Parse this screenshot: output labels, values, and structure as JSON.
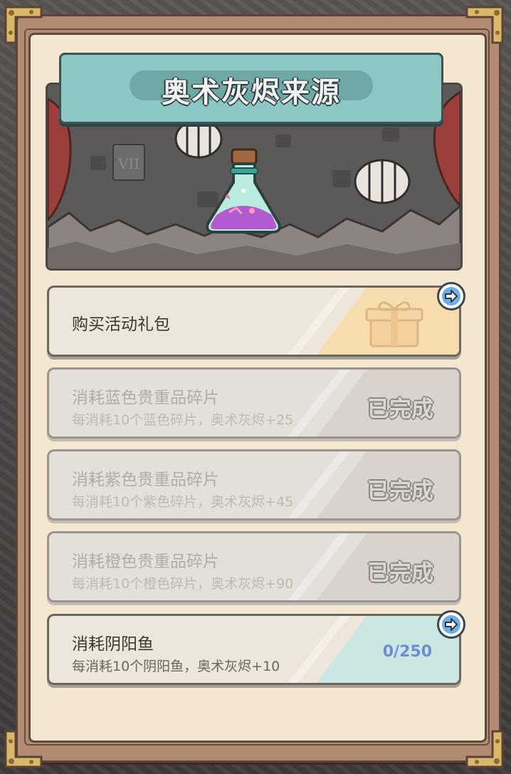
{
  "panel": {
    "title": "奥术灰烬来源"
  },
  "sources": [
    {
      "title": "购买活动礼包",
      "description": "",
      "status": "",
      "state": "available",
      "icon": "gift-box-icon"
    },
    {
      "title": "消耗蓝色贵重品碎片",
      "description": "每消耗10个蓝色碎片，奥术灰烬+25",
      "status": "已完成",
      "state": "completed"
    },
    {
      "title": "消耗紫色贵重品碎片",
      "description": "每消耗10个紫色碎片，奥术灰烬+45",
      "status": "已完成",
      "state": "completed"
    },
    {
      "title": "消耗橙色贵重品碎片",
      "description": "每消耗10个橙色碎片，奥术灰烬+90",
      "status": "已完成",
      "state": "completed"
    },
    {
      "title": "消耗阴阳鱼",
      "description": "每消耗10个阴阳鱼，奥术灰烬+10",
      "status": "0/250",
      "state": "in-progress"
    }
  ],
  "icons": {
    "banner_item": "potion-flask-icon",
    "go_button": "arrow-right-icon"
  },
  "colors": {
    "title_plate": "#8dc7c3",
    "progress_text": "#6d8fd0",
    "panel_bg": "#f3e7cf"
  }
}
